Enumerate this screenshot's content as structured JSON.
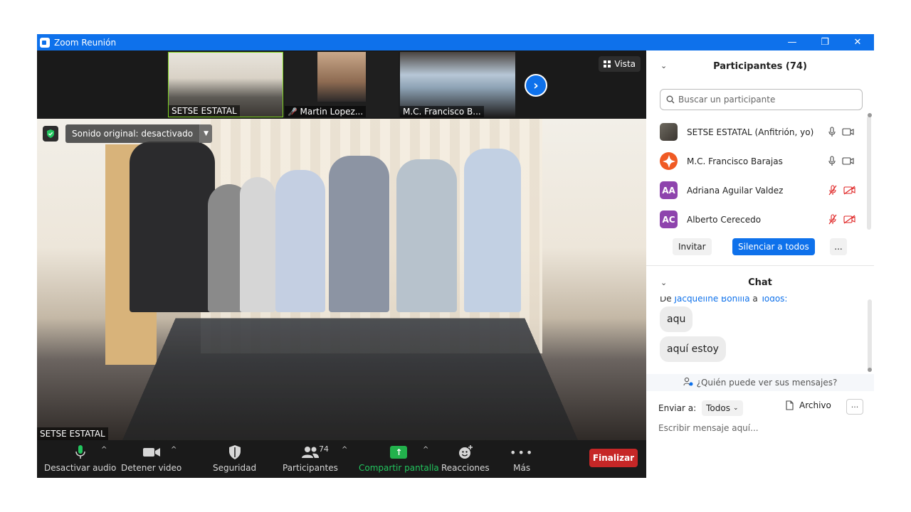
{
  "window": {
    "title": "Zoom Reunión",
    "minimize": "—",
    "restore": "❐",
    "close": "✕"
  },
  "thumbnails": [
    {
      "name": "SETSE ESTATAL"
    },
    {
      "name": "Martin Lopez..."
    },
    {
      "name": "M.C. Francisco B..."
    }
  ],
  "view_button": "Vista",
  "main_video": {
    "sound_label": "Sonido original: desactivado",
    "speaker_name": "SETSE ESTATAL"
  },
  "toolbar": {
    "mute": "Desactivar audio",
    "video": "Detener video",
    "security": "Seguridad",
    "participants": "Participantes",
    "participants_count": "74",
    "share": "Compartir pantalla",
    "reactions": "Reacciones",
    "more": "Más",
    "end": "Finalizar"
  },
  "participants_panel": {
    "title": "Participantes (74)",
    "search_placeholder": "Buscar un participante",
    "items": [
      {
        "name": "SETSE ESTATAL (Anfitrión, yo)",
        "initials": "",
        "muted": false
      },
      {
        "name": "M.C. Francisco Barajas",
        "initials": "",
        "muted": false
      },
      {
        "name": "Adriana Aguilar Valdez",
        "initials": "AA",
        "muted": true
      },
      {
        "name": "Alberto Cerecedo",
        "initials": "AC",
        "muted": true
      }
    ],
    "invite": "Invitar",
    "mute_all": "Silenciar a todos",
    "more": "..."
  },
  "chat": {
    "title": "Chat",
    "from_prefix": "De",
    "from_sender": "Jacqueline Bonilla",
    "from_middle": "a",
    "from_target": "Todos:",
    "messages": [
      "aqu",
      "aquí estoy"
    ],
    "who_can_see": "¿Quién puede ver sus mensajes?",
    "send_to_label": "Enviar a:",
    "send_to_value": "Todos",
    "file": "Archivo",
    "more": "···",
    "input_placeholder": "Escribir mensaje aquí..."
  },
  "colors": {
    "accent": "#0e71eb",
    "end": "#c62727",
    "share": "#22b14c",
    "avatar_purple": "#8e44ad",
    "muted_red": "#e02828"
  }
}
